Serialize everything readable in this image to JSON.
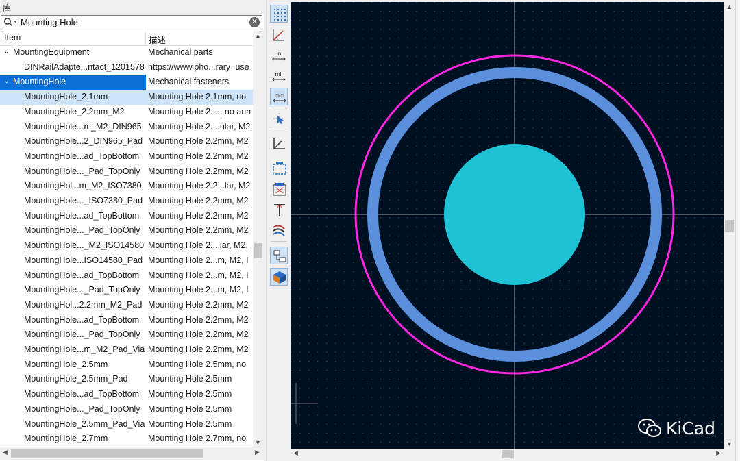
{
  "panel": {
    "title": "库"
  },
  "search": {
    "value": "Mounting Hole",
    "placeholder": ""
  },
  "table": {
    "headers": [
      "Item",
      "描述"
    ],
    "rows": [
      {
        "kind": "lib",
        "expanded": true,
        "name": "MountingEquipment",
        "desc": "Mechanical parts"
      },
      {
        "kind": "item",
        "name": "DINRailAdapte...ntact_1201578",
        "desc": "https://www.pho...rary=use"
      },
      {
        "kind": "lib",
        "expanded": true,
        "selected": true,
        "name": "MountingHole",
        "desc": "Mechanical fasteners"
      },
      {
        "kind": "item",
        "selected": true,
        "name": "MountingHole_2.1mm",
        "desc": "Mounting Hole 2.1mm, no"
      },
      {
        "kind": "item",
        "name": "MountingHole_2.2mm_M2",
        "desc": "Mounting Hole 2...., no ann"
      },
      {
        "kind": "item",
        "name": "MountingHole...m_M2_DIN965",
        "desc": "Mounting Hole 2....ular, M2"
      },
      {
        "kind": "item",
        "name": "MountingHole...2_DIN965_Pad",
        "desc": "Mounting Hole 2.2mm, M2"
      },
      {
        "kind": "item",
        "name": "MountingHole...ad_TopBottom",
        "desc": "Mounting Hole 2.2mm, M2"
      },
      {
        "kind": "item",
        "name": "MountingHole..._Pad_TopOnly",
        "desc": "Mounting Hole 2.2mm, M2"
      },
      {
        "kind": "item",
        "name": "MountingHol...m_M2_ISO7380",
        "desc": "Mounting Hole 2.2...lar, M2"
      },
      {
        "kind": "item",
        "name": "MountingHole..._ISO7380_Pad",
        "desc": "Mounting Hole 2.2mm, M2"
      },
      {
        "kind": "item",
        "name": "MountingHole...ad_TopBottom",
        "desc": "Mounting Hole 2.2mm, M2"
      },
      {
        "kind": "item",
        "name": "MountingHole..._Pad_TopOnly",
        "desc": "Mounting Hole 2.2mm, M2"
      },
      {
        "kind": "item",
        "name": "MountingHole..._M2_ISO14580",
        "desc": "Mounting Hole 2....lar, M2,"
      },
      {
        "kind": "item",
        "name": "MountingHole...ISO14580_Pad",
        "desc": "Mounting Hole 2...m, M2, I"
      },
      {
        "kind": "item",
        "name": "MountingHole...ad_TopBottom",
        "desc": "Mounting Hole 2...m, M2, I"
      },
      {
        "kind": "item",
        "name": "MountingHole..._Pad_TopOnly",
        "desc": "Mounting Hole 2...m, M2, I"
      },
      {
        "kind": "item",
        "name": "MountingHol...2.2mm_M2_Pad",
        "desc": "Mounting Hole 2.2mm, M2"
      },
      {
        "kind": "item",
        "name": "MountingHole...ad_TopBottom",
        "desc": "Mounting Hole 2.2mm, M2"
      },
      {
        "kind": "item",
        "name": "MountingHole..._Pad_TopOnly",
        "desc": "Mounting Hole 2.2mm, M2"
      },
      {
        "kind": "item",
        "name": "MountingHole...m_M2_Pad_Via",
        "desc": "Mounting Hole 2.2mm, M2"
      },
      {
        "kind": "item",
        "name": "MountingHole_2.5mm",
        "desc": "Mounting Hole 2.5mm, no"
      },
      {
        "kind": "item",
        "name": "MountingHole_2.5mm_Pad",
        "desc": "Mounting Hole 2.5mm"
      },
      {
        "kind": "item",
        "name": "MountingHole...ad_TopBottom",
        "desc": "Mounting Hole 2.5mm"
      },
      {
        "kind": "item",
        "name": "MountingHole..._Pad_TopOnly",
        "desc": "Mounting Hole 2.5mm"
      },
      {
        "kind": "item",
        "name": "MountingHole_2.5mm_Pad_Via",
        "desc": "Mounting Hole 2.5mm"
      },
      {
        "kind": "item",
        "name": "MountingHole_2.7mm",
        "desc": "Mounting Hole 2.7mm, no"
      }
    ]
  },
  "toolbar": {
    "buttons": [
      {
        "name": "grid-toggle-icon",
        "active": true
      },
      {
        "name": "polar-coords-icon",
        "active": false
      },
      {
        "name": "units-inches-icon",
        "active": false,
        "label": "in"
      },
      {
        "name": "units-mils-icon",
        "active": false,
        "label": "mil"
      },
      {
        "name": "units-mm-icon",
        "active": true,
        "label": "mm"
      },
      {
        "name": "cursor-style-icon",
        "active": false
      },
      {
        "name": "local-origin-icon",
        "active": false
      },
      {
        "name": "pad-sketch-icon",
        "active": false
      },
      {
        "name": "text-sketch-icon",
        "active": false
      },
      {
        "name": "graphic-sketch-icon",
        "active": false
      },
      {
        "name": "contrast-mode-icon",
        "active": false
      },
      {
        "name": "tree-panel-icon",
        "active": true
      },
      {
        "name": "3d-viewer-icon",
        "active": true
      }
    ]
  },
  "colors": {
    "canvas_bg": "#001023",
    "courtyard": "#ff26e2",
    "fab_ring": "#5a8fdc",
    "pad": "#1ec2d4",
    "selection": "#0b6fd8",
    "selection_item": "#cde3f7"
  },
  "watermark": {
    "text": "KiCad"
  }
}
